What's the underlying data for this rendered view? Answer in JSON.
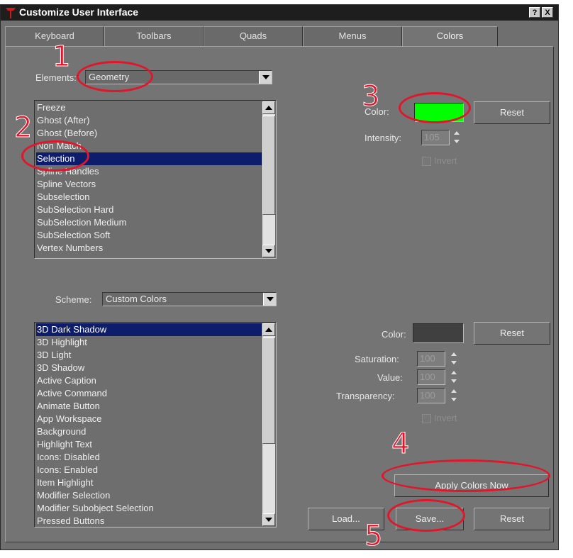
{
  "window": {
    "title": "Customize User Interface",
    "help_btn": "?",
    "close_btn": "X"
  },
  "tabs": [
    {
      "label": "Keyboard"
    },
    {
      "label": "Toolbars"
    },
    {
      "label": "Quads"
    },
    {
      "label": "Menus"
    },
    {
      "label": "Colors",
      "active": true
    }
  ],
  "elements_section": {
    "label": "Elements:",
    "combo_value": "Geometry",
    "list": [
      "Freeze",
      "Ghost (After)",
      "Ghost (Before)",
      "Non Match",
      "Selection",
      "Spline Handles",
      "Spline Vectors",
      "Subselection",
      "SubSelection Hard",
      "SubSelection Medium",
      "SubSelection Soft",
      "Vertex Numbers"
    ],
    "selected": "Selection"
  },
  "color_panel_top": {
    "color_label": "Color:",
    "color_hex": "#00ff00",
    "reset_label": "Reset",
    "intensity_label": "Intensity:",
    "intensity_value": "105",
    "invert_label": "Invert"
  },
  "scheme_section": {
    "label": "Scheme:",
    "combo_value": "Custom Colors",
    "list": [
      "3D Dark Shadow",
      "3D Highlight",
      "3D Light",
      "3D Shadow",
      "Active Caption",
      "Active Command",
      "Animate Button",
      "App Workspace",
      "Background",
      "Highlight Text",
      "Icons: Disabled",
      "Icons: Enabled",
      "Item Highlight",
      "Modifier Selection",
      "Modifier Subobject Selection",
      "Pressed Buttons"
    ],
    "selected": "3D Dark Shadow"
  },
  "color_panel_bottom": {
    "color_label": "Color:",
    "color_hex": "#404040",
    "reset_label": "Reset",
    "saturation_label": "Saturation:",
    "saturation_value": "100",
    "value_label": "Value:",
    "value_value": "100",
    "transparency_label": "Transparency:",
    "transparency_value": "100",
    "invert_label": "Invert"
  },
  "buttons": {
    "apply": "Apply Colors Now",
    "load": "Load...",
    "save": "Save...",
    "reset": "Reset"
  },
  "annotations": {
    "n1": "1",
    "n2": "2",
    "n3": "3",
    "n4": "4",
    "n5": "5",
    "color": "#e0162b"
  }
}
